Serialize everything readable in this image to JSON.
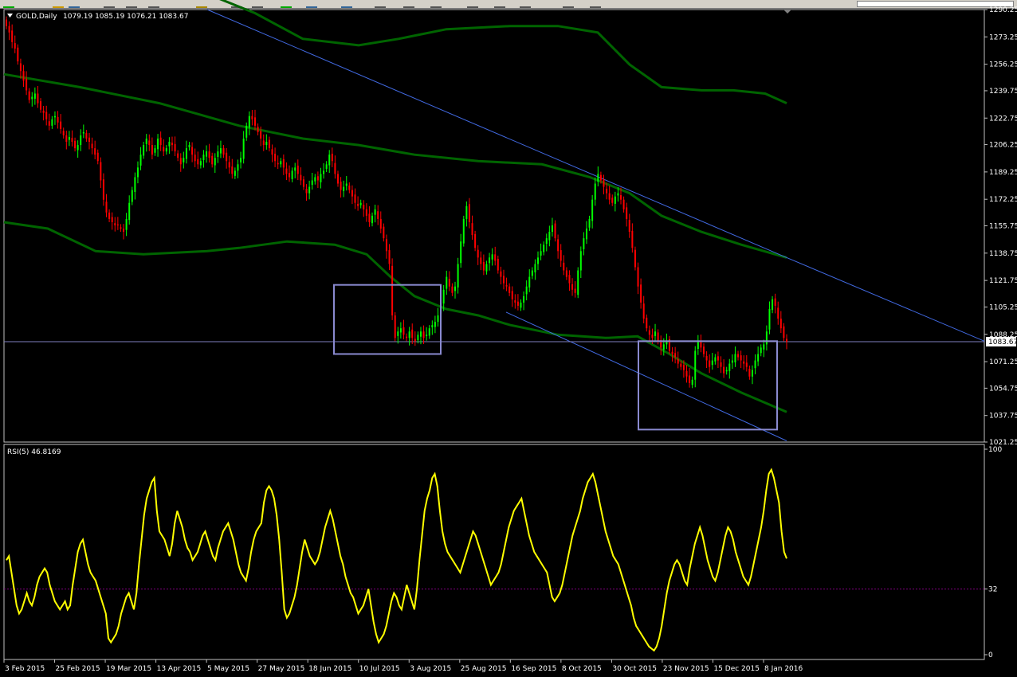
{
  "chart_data": [
    {
      "type": "candlestick",
      "symbol_label": "GOLD,Daily",
      "ohlc_label": "1079.19 1085.19 1076.21 1083.67",
      "current_price_label": "1083.67",
      "ylim": [
        1021.25,
        1290.25
      ],
      "yticks": [
        "1290.25",
        "1273.25",
        "1256.25",
        "1239.75",
        "1222.75",
        "1206.25",
        "1189.25",
        "1172.25",
        "1155.75",
        "1138.75",
        "1121.75",
        "1105.25",
        "1088.25",
        "1071.25",
        "1054.75",
        "1037.75",
        "1021.25"
      ],
      "ytick_values": [
        1290.25,
        1273.25,
        1256.25,
        1239.75,
        1222.75,
        1206.25,
        1189.25,
        1172.25,
        1155.75,
        1138.75,
        1121.75,
        1105.25,
        1088.25,
        1071.25,
        1054.75,
        1037.75,
        1021.25
      ],
      "colors": {
        "bull": "#00ff00",
        "bear": "#ff0000",
        "band": "#006400",
        "trend": "#4169e1",
        "box": "#8a8ad0",
        "hline": "#8080c0"
      },
      "closes": [
        1280,
        1276,
        1270,
        1266,
        1258,
        1252,
        1246,
        1240,
        1234,
        1236,
        1238,
        1232,
        1228,
        1226,
        1222,
        1218,
        1222,
        1224,
        1220,
        1216,
        1212,
        1208,
        1211,
        1208,
        1204,
        1206,
        1212,
        1214,
        1210,
        1208,
        1204,
        1200,
        1196,
        1184,
        1172,
        1164,
        1160,
        1158,
        1156,
        1156,
        1154,
        1152,
        1160,
        1170,
        1178,
        1186,
        1192,
        1200,
        1206,
        1210,
        1206,
        1200,
        1204,
        1210,
        1206,
        1202,
        1204,
        1208,
        1206,
        1202,
        1198,
        1194,
        1198,
        1204,
        1206,
        1200,
        1196,
        1194,
        1196,
        1200,
        1202,
        1198,
        1194,
        1198,
        1202,
        1204,
        1200,
        1196,
        1192,
        1188,
        1190,
        1194,
        1198,
        1210,
        1218,
        1224,
        1222,
        1218,
        1214,
        1210,
        1206,
        1208,
        1204,
        1200,
        1196,
        1194,
        1196,
        1192,
        1188,
        1186,
        1190,
        1192,
        1188,
        1184,
        1180,
        1176,
        1180,
        1184,
        1186,
        1184,
        1188,
        1190,
        1194,
        1200,
        1196,
        1188,
        1182,
        1178,
        1180,
        1182,
        1178,
        1174,
        1170,
        1168,
        1170,
        1166,
        1162,
        1158,
        1162,
        1166,
        1160,
        1154,
        1148,
        1140,
        1132,
        1100,
        1086,
        1090,
        1092,
        1088,
        1086,
        1090,
        1086,
        1084,
        1088,
        1090,
        1086,
        1088,
        1092,
        1094,
        1096,
        1100,
        1108,
        1116,
        1124,
        1118,
        1114,
        1118,
        1132,
        1146,
        1160,
        1168,
        1158,
        1150,
        1142,
        1136,
        1132,
        1128,
        1132,
        1136,
        1138,
        1134,
        1128,
        1124,
        1120,
        1118,
        1114,
        1110,
        1108,
        1106,
        1108,
        1112,
        1118,
        1124,
        1128,
        1132,
        1136,
        1140,
        1144,
        1148,
        1152,
        1156,
        1148,
        1140,
        1134,
        1128,
        1124,
        1120,
        1116,
        1114,
        1128,
        1140,
        1148,
        1154,
        1160,
        1172,
        1182,
        1188,
        1184,
        1180,
        1176,
        1172,
        1170,
        1174,
        1176,
        1172,
        1166,
        1160,
        1152,
        1142,
        1130,
        1118,
        1108,
        1098,
        1092,
        1088,
        1086,
        1090,
        1084,
        1080,
        1082,
        1084,
        1078,
        1076,
        1074,
        1070,
        1068,
        1066,
        1062,
        1058,
        1060,
        1078,
        1084,
        1080,
        1076,
        1072,
        1068,
        1072,
        1074,
        1072,
        1068,
        1064,
        1066,
        1070,
        1072,
        1076,
        1074,
        1072,
        1070,
        1068,
        1062,
        1066,
        1072,
        1076,
        1080,
        1082,
        1090,
        1104,
        1110,
        1106,
        1098,
        1092,
        1086,
        1083.67
      ],
      "upper_band": [
        [
          5,
          1320
        ],
        [
          150,
          1310
        ],
        [
          260,
          1300
        ],
        [
          320,
          1288
        ],
        [
          380,
          1272
        ],
        [
          450,
          1268
        ],
        [
          500,
          1272
        ],
        [
          560,
          1278
        ],
        [
          640,
          1280
        ],
        [
          700,
          1280
        ],
        [
          750,
          1276
        ],
        [
          790,
          1256
        ],
        [
          830,
          1242
        ],
        [
          880,
          1240
        ],
        [
          920,
          1240
        ],
        [
          960,
          1238
        ],
        [
          987,
          1232
        ]
      ],
      "middle_band": [
        [
          5,
          1250
        ],
        [
          100,
          1242
        ],
        [
          200,
          1232
        ],
        [
          300,
          1218
        ],
        [
          380,
          1210
        ],
        [
          450,
          1206
        ],
        [
          520,
          1200
        ],
        [
          600,
          1196
        ],
        [
          680,
          1194
        ],
        [
          740,
          1186
        ],
        [
          790,
          1176
        ],
        [
          830,
          1162
        ],
        [
          880,
          1152
        ],
        [
          930,
          1144
        ],
        [
          987,
          1136
        ]
      ],
      "lower_band": [
        [
          5,
          1158
        ],
        [
          60,
          1154
        ],
        [
          120,
          1140
        ],
        [
          180,
          1138
        ],
        [
          260,
          1140
        ],
        [
          300,
          1142
        ],
        [
          360,
          1146
        ],
        [
          420,
          1144
        ],
        [
          460,
          1138
        ],
        [
          490,
          1124
        ],
        [
          520,
          1112
        ],
        [
          560,
          1104
        ],
        [
          600,
          1100
        ],
        [
          640,
          1094
        ],
        [
          700,
          1088
        ],
        [
          760,
          1086
        ],
        [
          800,
          1087
        ],
        [
          840,
          1076
        ],
        [
          880,
          1064
        ],
        [
          930,
          1052
        ],
        [
          987,
          1040
        ]
      ],
      "trend_lines": [
        [
          [
            260,
            1290.25
          ],
          [
            987,
            1136
          ],
          [
            1235,
            1084
          ]
        ],
        [
          [
            635,
            1102
          ],
          [
            987,
            1022
          ]
        ]
      ],
      "boxes": [
        [
          [
            419,
            1119
          ],
          [
            553,
            1076
          ]
        ],
        [
          [
            801,
            1084
          ],
          [
            975,
            1029
          ]
        ]
      ],
      "hline": 1083.67
    },
    {
      "type": "line",
      "label": "RSI(5) 46.8169",
      "ylim": [
        0,
        100
      ],
      "yticks": [
        "100",
        "32",
        "0"
      ],
      "ytick_values": [
        100,
        32,
        0
      ],
      "level": 32,
      "color": "#ffff00",
      "values": [
        46,
        48,
        40,
        32,
        24,
        20,
        22,
        26,
        30,
        26,
        24,
        28,
        34,
        38,
        40,
        42,
        40,
        34,
        30,
        26,
        24,
        22,
        24,
        26,
        22,
        24,
        34,
        42,
        50,
        54,
        56,
        50,
        44,
        40,
        38,
        36,
        32,
        28,
        24,
        20,
        8,
        6,
        8,
        10,
        14,
        20,
        24,
        28,
        30,
        26,
        22,
        30,
        44,
        56,
        68,
        76,
        80,
        84,
        86,
        70,
        60,
        58,
        56,
        52,
        48,
        54,
        64,
        70,
        66,
        62,
        56,
        52,
        50,
        46,
        48,
        50,
        54,
        58,
        60,
        56,
        52,
        48,
        46,
        52,
        56,
        60,
        62,
        64,
        60,
        56,
        50,
        44,
        40,
        38,
        36,
        42,
        50,
        56,
        60,
        62,
        64,
        74,
        80,
        82,
        80,
        76,
        68,
        56,
        40,
        22,
        18,
        20,
        24,
        28,
        34,
        42,
        50,
        56,
        52,
        48,
        46,
        44,
        46,
        50,
        56,
        62,
        66,
        70,
        66,
        60,
        54,
        48,
        44,
        38,
        34,
        30,
        28,
        24,
        20,
        22,
        24,
        28,
        32,
        24,
        16,
        10,
        6,
        8,
        10,
        14,
        20,
        26,
        30,
        28,
        24,
        22,
        28,
        34,
        30,
        26,
        22,
        32,
        46,
        58,
        70,
        76,
        80,
        86,
        88,
        82,
        70,
        60,
        54,
        50,
        48,
        46,
        44,
        42,
        40,
        44,
        48,
        52,
        56,
        60,
        58,
        54,
        50,
        46,
        42,
        38,
        34,
        36,
        38,
        40,
        44,
        50,
        56,
        62,
        66,
        70,
        72,
        74,
        76,
        70,
        64,
        58,
        54,
        50,
        48,
        46,
        44,
        42,
        40,
        34,
        28,
        26,
        28,
        30,
        34,
        40,
        46,
        52,
        58,
        62,
        66,
        70,
        76,
        80,
        84,
        86,
        88,
        84,
        78,
        72,
        66,
        60,
        56,
        52,
        48,
        46,
        44,
        40,
        36,
        32,
        28,
        24,
        18,
        14,
        12,
        10,
        8,
        6,
        4,
        3,
        2,
        4,
        8,
        14,
        22,
        30,
        36,
        40,
        44,
        46,
        44,
        40,
        36,
        34,
        42,
        48,
        54,
        58,
        62,
        58,
        52,
        46,
        42,
        38,
        36,
        40,
        46,
        52,
        58,
        62,
        60,
        56,
        50,
        46,
        42,
        38,
        36,
        34,
        38,
        44,
        50,
        56,
        62,
        70,
        80,
        88,
        90,
        86,
        80,
        74,
        60,
        50,
        46.8169
      ]
    }
  ],
  "x_axis": {
    "labels": [
      "3 Feb 2015",
      "25 Feb 2015",
      "19 Mar 2015",
      "13 Apr 2015",
      "5 May 2015",
      "27 May 2015",
      "18 Jun 2015",
      "10 Jul 2015",
      "3 Aug 2015",
      "25 Aug 2015",
      "16 Sep 2015",
      "8 Oct 2015",
      "30 Oct 2015",
      "23 Nov 2015",
      "15 Dec 2015",
      "8 Jan 2016"
    ]
  }
}
